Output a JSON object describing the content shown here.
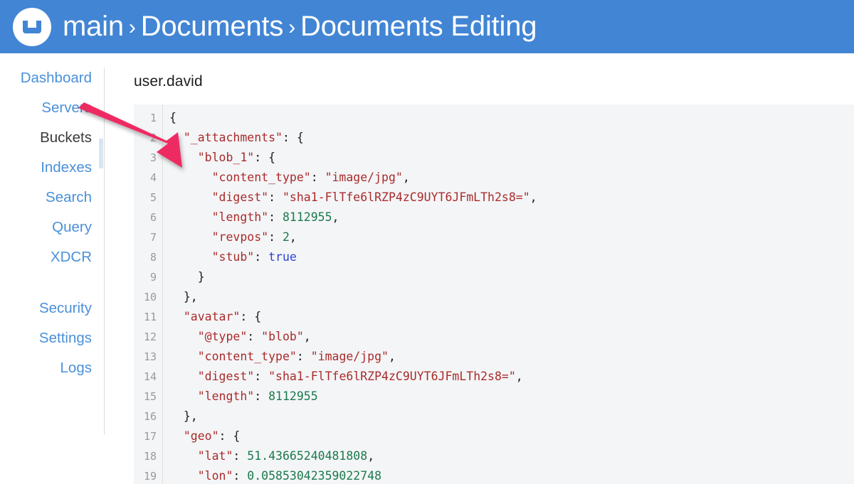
{
  "header": {
    "logo_icon": "couchbase-logo-icon",
    "breadcrumb": [
      {
        "label": "main"
      },
      {
        "label": "Documents"
      },
      {
        "label": "Documents Editing"
      }
    ],
    "separator": "›",
    "background_color": "#4285d4"
  },
  "sidebar": {
    "primary_items": [
      {
        "label": "Dashboard",
        "active": false
      },
      {
        "label": "Servers",
        "active": false
      },
      {
        "label": "Buckets",
        "active": true
      },
      {
        "label": "Indexes",
        "active": false
      },
      {
        "label": "Search",
        "active": false
      },
      {
        "label": "Query",
        "active": false
      },
      {
        "label": "XDCR",
        "active": false
      }
    ],
    "secondary_items": [
      {
        "label": "Security",
        "active": false
      },
      {
        "label": "Settings",
        "active": false
      },
      {
        "label": "Logs",
        "active": false
      }
    ],
    "link_color": "#4a90d9",
    "active_color": "#3b3b3b"
  },
  "document": {
    "id": "user.david",
    "editor": {
      "background_color": "#f4f5f7",
      "key_color": "#a92b2b",
      "string_color": "#a92b2b",
      "number_color": "#1a7a4c",
      "boolean_color": "#2c3fd4",
      "lines": [
        {
          "n": "1",
          "tokens": [
            {
              "t": "{",
              "c": "punct"
            }
          ]
        },
        {
          "n": "2",
          "tokens": [
            {
              "t": "  ",
              "c": "punct"
            },
            {
              "t": "\"_attachments\"",
              "c": "key"
            },
            {
              "t": ": {",
              "c": "punct"
            }
          ]
        },
        {
          "n": "3",
          "tokens": [
            {
              "t": "    ",
              "c": "punct"
            },
            {
              "t": "\"blob_1\"",
              "c": "key"
            },
            {
              "t": ": {",
              "c": "punct"
            }
          ]
        },
        {
          "n": "4",
          "tokens": [
            {
              "t": "      ",
              "c": "punct"
            },
            {
              "t": "\"content_type\"",
              "c": "key"
            },
            {
              "t": ": ",
              "c": "punct"
            },
            {
              "t": "\"image/jpg\"",
              "c": "str"
            },
            {
              "t": ",",
              "c": "punct"
            }
          ]
        },
        {
          "n": "5",
          "tokens": [
            {
              "t": "      ",
              "c": "punct"
            },
            {
              "t": "\"digest\"",
              "c": "key"
            },
            {
              "t": ": ",
              "c": "punct"
            },
            {
              "t": "\"sha1-FlTfe6lRZP4zC9UYT6JFmLTh2s8=\"",
              "c": "str"
            },
            {
              "t": ",",
              "c": "punct"
            }
          ]
        },
        {
          "n": "6",
          "tokens": [
            {
              "t": "      ",
              "c": "punct"
            },
            {
              "t": "\"length\"",
              "c": "key"
            },
            {
              "t": ": ",
              "c": "punct"
            },
            {
              "t": "8112955",
              "c": "num"
            },
            {
              "t": ",",
              "c": "punct"
            }
          ]
        },
        {
          "n": "7",
          "tokens": [
            {
              "t": "      ",
              "c": "punct"
            },
            {
              "t": "\"revpos\"",
              "c": "key"
            },
            {
              "t": ": ",
              "c": "punct"
            },
            {
              "t": "2",
              "c": "num"
            },
            {
              "t": ",",
              "c": "punct"
            }
          ]
        },
        {
          "n": "8",
          "tokens": [
            {
              "t": "      ",
              "c": "punct"
            },
            {
              "t": "\"stub\"",
              "c": "key"
            },
            {
              "t": ": ",
              "c": "punct"
            },
            {
              "t": "true",
              "c": "bool"
            }
          ]
        },
        {
          "n": "9",
          "tokens": [
            {
              "t": "    }",
              "c": "punct"
            }
          ]
        },
        {
          "n": "10",
          "tokens": [
            {
              "t": "  },",
              "c": "punct"
            }
          ]
        },
        {
          "n": "11",
          "tokens": [
            {
              "t": "  ",
              "c": "punct"
            },
            {
              "t": "\"avatar\"",
              "c": "key"
            },
            {
              "t": ": {",
              "c": "punct"
            }
          ]
        },
        {
          "n": "12",
          "tokens": [
            {
              "t": "    ",
              "c": "punct"
            },
            {
              "t": "\"@type\"",
              "c": "key"
            },
            {
              "t": ": ",
              "c": "punct"
            },
            {
              "t": "\"blob\"",
              "c": "str"
            },
            {
              "t": ",",
              "c": "punct"
            }
          ]
        },
        {
          "n": "13",
          "tokens": [
            {
              "t": "    ",
              "c": "punct"
            },
            {
              "t": "\"content_type\"",
              "c": "key"
            },
            {
              "t": ": ",
              "c": "punct"
            },
            {
              "t": "\"image/jpg\"",
              "c": "str"
            },
            {
              "t": ",",
              "c": "punct"
            }
          ]
        },
        {
          "n": "14",
          "tokens": [
            {
              "t": "    ",
              "c": "punct"
            },
            {
              "t": "\"digest\"",
              "c": "key"
            },
            {
              "t": ": ",
              "c": "punct"
            },
            {
              "t": "\"sha1-FlTfe6lRZP4zC9UYT6JFmLTh2s8=\"",
              "c": "str"
            },
            {
              "t": ",",
              "c": "punct"
            }
          ]
        },
        {
          "n": "15",
          "tokens": [
            {
              "t": "    ",
              "c": "punct"
            },
            {
              "t": "\"length\"",
              "c": "key"
            },
            {
              "t": ": ",
              "c": "punct"
            },
            {
              "t": "8112955",
              "c": "num"
            }
          ]
        },
        {
          "n": "16",
          "tokens": [
            {
              "t": "  },",
              "c": "punct"
            }
          ]
        },
        {
          "n": "17",
          "tokens": [
            {
              "t": "  ",
              "c": "punct"
            },
            {
              "t": "\"geo\"",
              "c": "key"
            },
            {
              "t": ": {",
              "c": "punct"
            }
          ]
        },
        {
          "n": "18",
          "tokens": [
            {
              "t": "    ",
              "c": "punct"
            },
            {
              "t": "\"lat\"",
              "c": "key"
            },
            {
              "t": ": ",
              "c": "punct"
            },
            {
              "t": "51.43665240481808",
              "c": "num"
            },
            {
              "t": ",",
              "c": "punct"
            }
          ]
        },
        {
          "n": "19",
          "tokens": [
            {
              "t": "    ",
              "c": "punct"
            },
            {
              "t": "\"lon\"",
              "c": "key"
            },
            {
              "t": ": ",
              "c": "punct"
            },
            {
              "t": "0.05853042359022748",
              "c": "num"
            }
          ]
        }
      ]
    }
  },
  "annotation": {
    "arrow_icon": "pointer-arrow-icon",
    "color": "#ee2a62"
  }
}
